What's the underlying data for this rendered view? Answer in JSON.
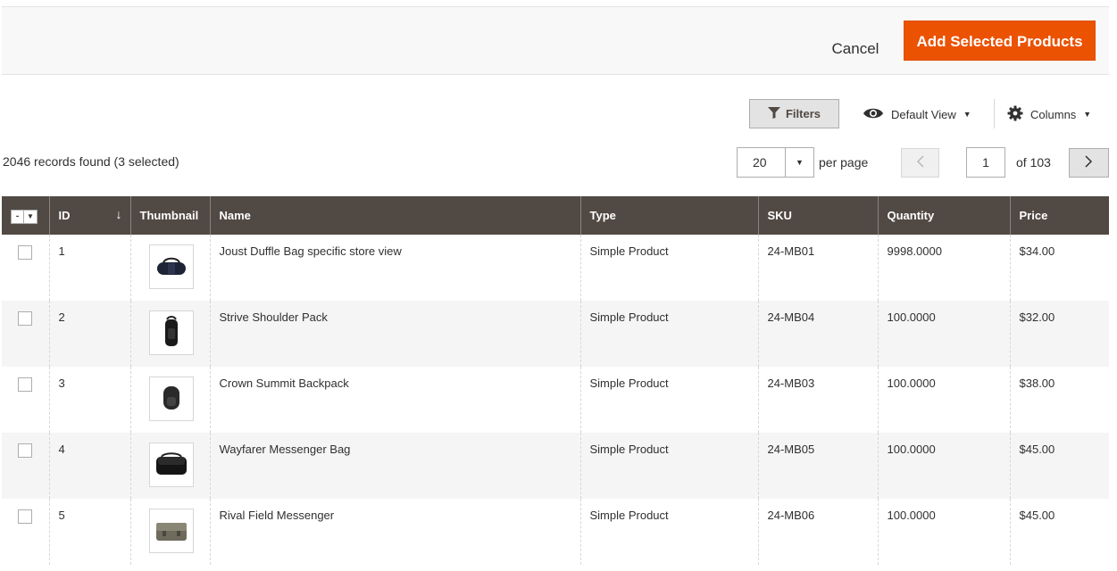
{
  "actions": {
    "cancel_label": "Cancel",
    "add_label": "Add Selected Products",
    "accent": "#eb5202"
  },
  "toolbar": {
    "filters_label": "Filters",
    "view_label": "Default View",
    "columns_label": "Columns"
  },
  "summary": {
    "records_text": "2046 records found (3 selected)"
  },
  "pager": {
    "per_page_value": "20",
    "per_page_label": "per page",
    "current_page": "1",
    "of_label": "of 103"
  },
  "grid": {
    "header_color": "#514943",
    "columns": [
      "ID",
      "Thumbnail",
      "Name",
      "Type",
      "SKU",
      "Quantity",
      "Price"
    ],
    "mass_select_symbol": "-",
    "sort_symbol": "↓",
    "rows": [
      {
        "id": "1",
        "thumb": "duffle-bag",
        "name": "Joust Duffle Bag specific store view",
        "type": "Simple Product",
        "sku": "24-MB01",
        "qty": "9998.0000",
        "price": "$34.00"
      },
      {
        "id": "2",
        "thumb": "shoulder-pack",
        "name": "Strive Shoulder Pack",
        "type": "Simple Product",
        "sku": "24-MB04",
        "qty": "100.0000",
        "price": "$32.00"
      },
      {
        "id": "3",
        "thumb": "backpack",
        "name": "Crown Summit Backpack",
        "type": "Simple Product",
        "sku": "24-MB03",
        "qty": "100.0000",
        "price": "$38.00"
      },
      {
        "id": "4",
        "thumb": "messenger-bag",
        "name": "Wayfarer Messenger Bag",
        "type": "Simple Product",
        "sku": "24-MB05",
        "qty": "100.0000",
        "price": "$45.00"
      },
      {
        "id": "5",
        "thumb": "field-messenger",
        "name": "Rival Field Messenger",
        "type": "Simple Product",
        "sku": "24-MB06",
        "qty": "100.0000",
        "price": "$45.00"
      }
    ]
  }
}
